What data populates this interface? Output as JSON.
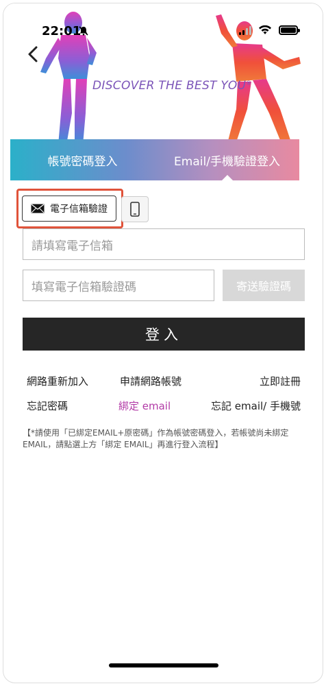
{
  "status_bar": {
    "time": "22:01"
  },
  "hero": {
    "tagline": "DISCOVER THE BEST YOU",
    "trademark": "®"
  },
  "tabs": [
    {
      "label": "帳號密碼登入",
      "active": false
    },
    {
      "label": "Email/手機驗證登入",
      "active": true
    }
  ],
  "method": {
    "email_label": "電子信箱驗證"
  },
  "form": {
    "email_placeholder": "請填寫電子信箱",
    "code_placeholder": "填寫電子信箱驗證碼",
    "send_code_label": "寄送驗證碼",
    "login_label": "登入"
  },
  "links": {
    "rejoin": "網路重新加入",
    "apply_account": "申請網路帳號",
    "register_now": "立即註冊",
    "forgot_password": "忘記密碼",
    "bind_email": "綁定 email",
    "forgot_email_phone": "忘記 email/ 手機號"
  },
  "note": "【*請使用「已綁定EMAIL+原密碼」作為帳號密碼登入，若帳號尚未綁定 EMAIL，請點選上方「綁定 EMAIL」再進行登入流程】",
  "colors": {
    "highlight": "#e0533a",
    "accent_purple": "#b23aa6",
    "login_button": "#262626"
  }
}
